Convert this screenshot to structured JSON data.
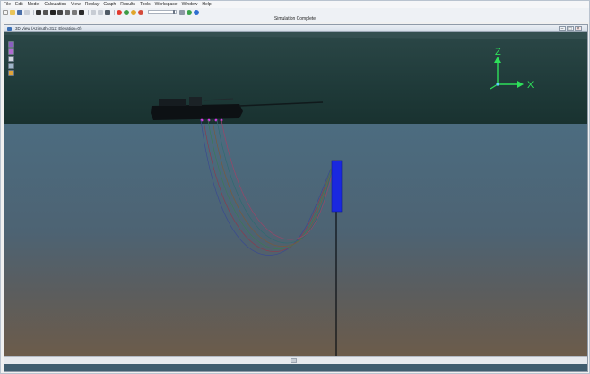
{
  "menu": [
    "File",
    "Edit",
    "Model",
    "Calculation",
    "View",
    "Replay",
    "Graph",
    "Results",
    "Tools",
    "Workspace",
    "Window",
    "Help"
  ],
  "status_text": "Simulation Complete",
  "view": {
    "title": "3D View (Azimuth=312; Elevation=0)",
    "axis_z": "Z",
    "axis_x": "X"
  },
  "colors": {
    "sky": "#1f3b3a",
    "sea_surface": "#4b6a7e",
    "sea_deep": "#6b5e4e",
    "buoy": "#1a28e0",
    "axis": "#2ee05a"
  },
  "toolbar_icons": [
    "new-icon",
    "open-icon",
    "save-icon",
    "print-icon",
    "run-icon",
    "pause-icon",
    "stop-icon",
    "reset-icon",
    "step-icon",
    "replay-icon",
    "graph-icon",
    "results-icon",
    "help-icon"
  ]
}
